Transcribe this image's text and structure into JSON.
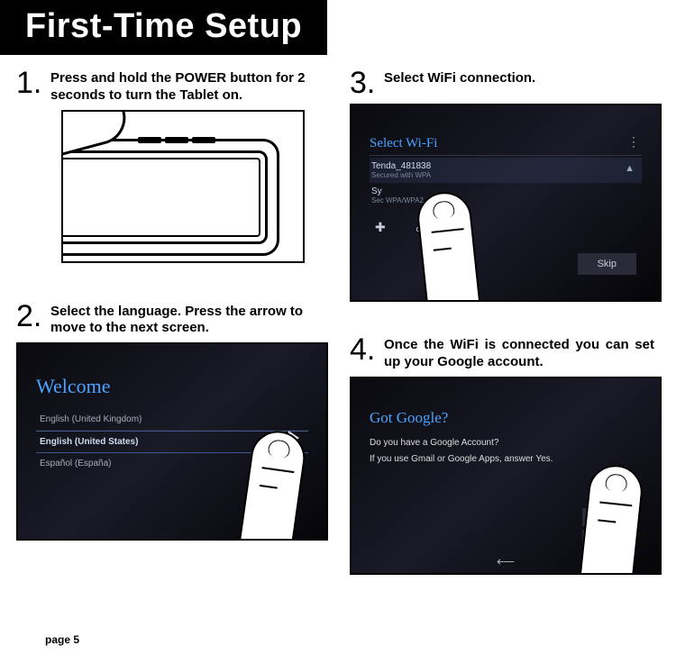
{
  "page_title": "First-Time Setup",
  "page_footer": "page 5",
  "steps": [
    {
      "num": "1.",
      "text": "Press and hold the POWER button for 2 seconds to turn the Tablet on."
    },
    {
      "num": "2.",
      "text": "Select the language. Press the arrow to move to the next screen."
    },
    {
      "num": "3.",
      "text": "Select WiFi connection."
    },
    {
      "num": "4.",
      "text": "Once the WiFi is connected you can set up your Google account."
    }
  ],
  "screen2": {
    "title": "Welcome",
    "langs": [
      "English (United Kingdom)",
      "English (United States)",
      "Español (España)"
    ]
  },
  "screen3": {
    "title": "Select Wi-Fi",
    "net1_name": "Tenda_481838",
    "net1_sub": "Secured with WPA",
    "net2_name": "Sy",
    "net2_sub": "Sec            WPA/WPA2",
    "add": "ork…",
    "skip": "Skip"
  },
  "screen4": {
    "title": "Got Google?",
    "line1": "Do you have a Google Account?",
    "line2": "If you use Gmail or Google Apps, answer Yes."
  }
}
